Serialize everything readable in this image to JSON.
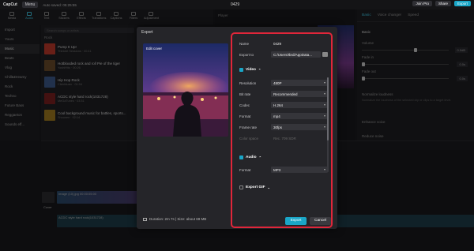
{
  "titlebar": {
    "app": "CapCut",
    "menu": "Menu",
    "autosave": "Auto saved: 05:25:55",
    "project": "0429",
    "join_pro": "Join Pro",
    "share": "Share",
    "export": "Export"
  },
  "toolbar": [
    {
      "label": "Media"
    },
    {
      "label": "Audio",
      "active": true
    },
    {
      "label": "Text"
    },
    {
      "label": "Stickers"
    },
    {
      "label": "Effects"
    },
    {
      "label": "Transitions"
    },
    {
      "label": "Captions"
    },
    {
      "label": "Filters"
    },
    {
      "label": "Adjustment"
    }
  ],
  "sidebar": [
    "Import",
    "Yours",
    "Music",
    "Beats",
    "Vlog",
    "Chill&Dreamy",
    "Rock",
    "Techno",
    "Future Bass",
    "Reggaeton",
    "Sounds eff..."
  ],
  "music": {
    "search_placeholder": "Search songs or artists",
    "category": "Rock",
    "tracks": [
      {
        "title": "Pump It Up!",
        "meta": "Thinkbit Sessions · 00:41",
        "color": "#c0392b"
      },
      {
        "title": "Hotblooded rock and roll Pie of the tiger",
        "meta": "YoshiHito · 00:26",
        "color": "#6b4b2a"
      },
      {
        "title": "Hip Hop Rock",
        "meta": "ClickMusic · 01:04",
        "color": "#3c5a8a"
      },
      {
        "title": "ACDC style hard rock(1031728)",
        "meta": "MeGaTunes · 03:31",
        "color": "#7a2020"
      },
      {
        "title": "Cool background music for battles, sports...",
        "meta": "Shounen · 02:14",
        "color": "#a07a20"
      }
    ]
  },
  "player": {
    "label": "Player"
  },
  "rpanel": {
    "tabs": [
      "Basic",
      "Voice changer",
      "Speed"
    ],
    "basic": "Basic",
    "volume_label": "Volume",
    "volume_value": "0.0dB",
    "fadein_label": "Fade in",
    "fadein_value": "0.0s",
    "fadeout_label": "Fade out",
    "fadeout_value": "0.0s",
    "normalize": "Normalize loudness",
    "normalize_desc": "Normalize the loudness of the selected clip or clips to a target level.",
    "enhance": "Enhance voice",
    "reduce": "Reduce noise"
  },
  "timeline": {
    "clip1": "Image (10).jpg  00:00:05:00",
    "clip2": "ACDC style hard rock(1031728)",
    "cover": "Cover"
  },
  "modal": {
    "title": "Export",
    "edit_cover": "Edit cover",
    "name_label": "Name",
    "name_value": "0429",
    "exportto_label": "Export to",
    "exportto_value": "C:/Users/Ibrd/AppData...",
    "video_section": "Video",
    "resolution_label": "Resolution",
    "resolution_value": "480P",
    "bitrate_label": "Bit rate",
    "bitrate_value": "Recommended",
    "codec_label": "Codec",
    "codec_value": "H.264",
    "format_label": "Format",
    "format_value": "mp4",
    "framerate_label": "Frame rate",
    "framerate_value": "30fps",
    "colorspace_label": "Color space",
    "colorspace_value": "Rec. 709 SDR",
    "audio_section": "Audio",
    "aformat_label": "Format",
    "aformat_value": "MP3",
    "gif_section": "Export GIF",
    "footer": "Duration: 2m 7s | Size: about 69 MB",
    "export_btn": "Export",
    "cancel_btn": "Cancel"
  },
  "colors": {
    "accent": "#1aa6c7",
    "highlight": "#e0263a"
  }
}
